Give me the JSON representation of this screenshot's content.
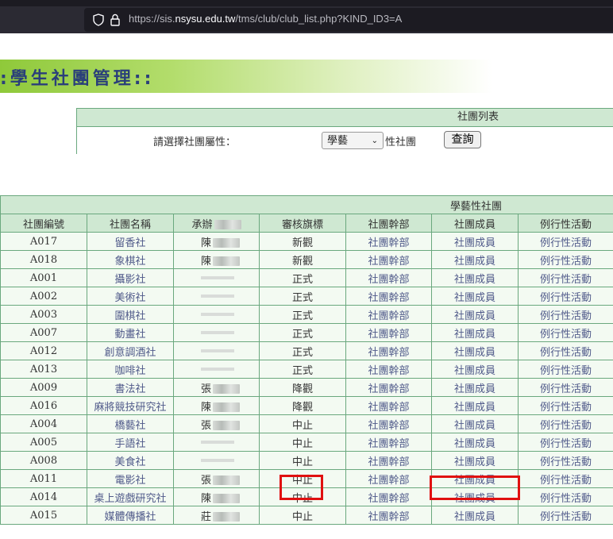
{
  "browser": {
    "url_prefix": "https://sis.",
    "url_host": "nsysu.edu.tw",
    "url_path": "/tms/club/club_list.php?KIND_ID3=A"
  },
  "banner": {
    "title": ":學生社團管理::"
  },
  "filter": {
    "header": "社團列表",
    "label": "請選擇社團屬性：",
    "selected": "學藝",
    "suffix": "性社團",
    "query_button": "查詢"
  },
  "table": {
    "title": "學藝性社團",
    "columns": [
      "社團編號",
      "社團名稱",
      "承辦",
      "審核旗標",
      "社團幹部",
      "社團成員",
      "例行性活動"
    ],
    "rows": [
      {
        "id": "A017",
        "name": "留香社",
        "leader": "陳",
        "flag": "新觀",
        "cadre": "社團幹部",
        "members": "社團成員",
        "activity": "例行性活動"
      },
      {
        "id": "A018",
        "name": "象棋社",
        "leader": "陳",
        "flag": "新觀",
        "cadre": "社團幹部",
        "members": "社團成員",
        "activity": "例行性活動"
      },
      {
        "id": "A001",
        "name": "攝影社",
        "leader": "",
        "flag": "正式",
        "cadre": "社團幹部",
        "members": "社團成員",
        "activity": "例行性活動"
      },
      {
        "id": "A002",
        "name": "美術社",
        "leader": "",
        "flag": "正式",
        "cadre": "社團幹部",
        "members": "社團成員",
        "activity": "例行性活動"
      },
      {
        "id": "A003",
        "name": "圍棋社",
        "leader": "",
        "flag": "正式",
        "cadre": "社團幹部",
        "members": "社團成員",
        "activity": "例行性活動"
      },
      {
        "id": "A007",
        "name": "動畫社",
        "leader": "",
        "flag": "正式",
        "cadre": "社團幹部",
        "members": "社團成員",
        "activity": "例行性活動"
      },
      {
        "id": "A012",
        "name": "創意調酒社",
        "leader": "",
        "flag": "正式",
        "cadre": "社團幹部",
        "members": "社團成員",
        "activity": "例行性活動"
      },
      {
        "id": "A013",
        "name": "咖啡社",
        "leader": "",
        "flag": "正式",
        "cadre": "社團幹部",
        "members": "社團成員",
        "activity": "例行性活動"
      },
      {
        "id": "A009",
        "name": "書法社",
        "leader": "張",
        "flag": "降觀",
        "cadre": "社團幹部",
        "members": "社團成員",
        "activity": "例行性活動"
      },
      {
        "id": "A016",
        "name": "麻將競技研究社",
        "leader": "陳",
        "flag": "降觀",
        "cadre": "社團幹部",
        "members": "社團成員",
        "activity": "例行性活動"
      },
      {
        "id": "A004",
        "name": "橋藝社",
        "leader": "張",
        "flag": "中止",
        "cadre": "社團幹部",
        "members": "社團成員",
        "activity": "例行性活動"
      },
      {
        "id": "A005",
        "name": "手語社",
        "leader": "",
        "flag": "中止",
        "cadre": "社團幹部",
        "members": "社團成員",
        "activity": "例行性活動"
      },
      {
        "id": "A008",
        "name": "美食社",
        "leader": "",
        "flag": "中止",
        "cadre": "社團幹部",
        "members": "社團成員",
        "activity": "例行性活動"
      },
      {
        "id": "A011",
        "name": "電影社",
        "leader": "張",
        "flag": "中止",
        "cadre": "社團幹部",
        "members": "社團成員",
        "activity": "例行性活動"
      },
      {
        "id": "A014",
        "name": "桌上遊戲研究社",
        "leader": "陳",
        "flag": "中止",
        "cadre": "社團幹部",
        "members": "社團成員",
        "activity": "例行性活動"
      },
      {
        "id": "A015",
        "name": "媒體傳播社",
        "leader": "莊",
        "flag": "中止",
        "cadre": "社團幹部",
        "members": "社團成員",
        "activity": "例行性活動"
      }
    ]
  },
  "highlight_color": "#e01010"
}
